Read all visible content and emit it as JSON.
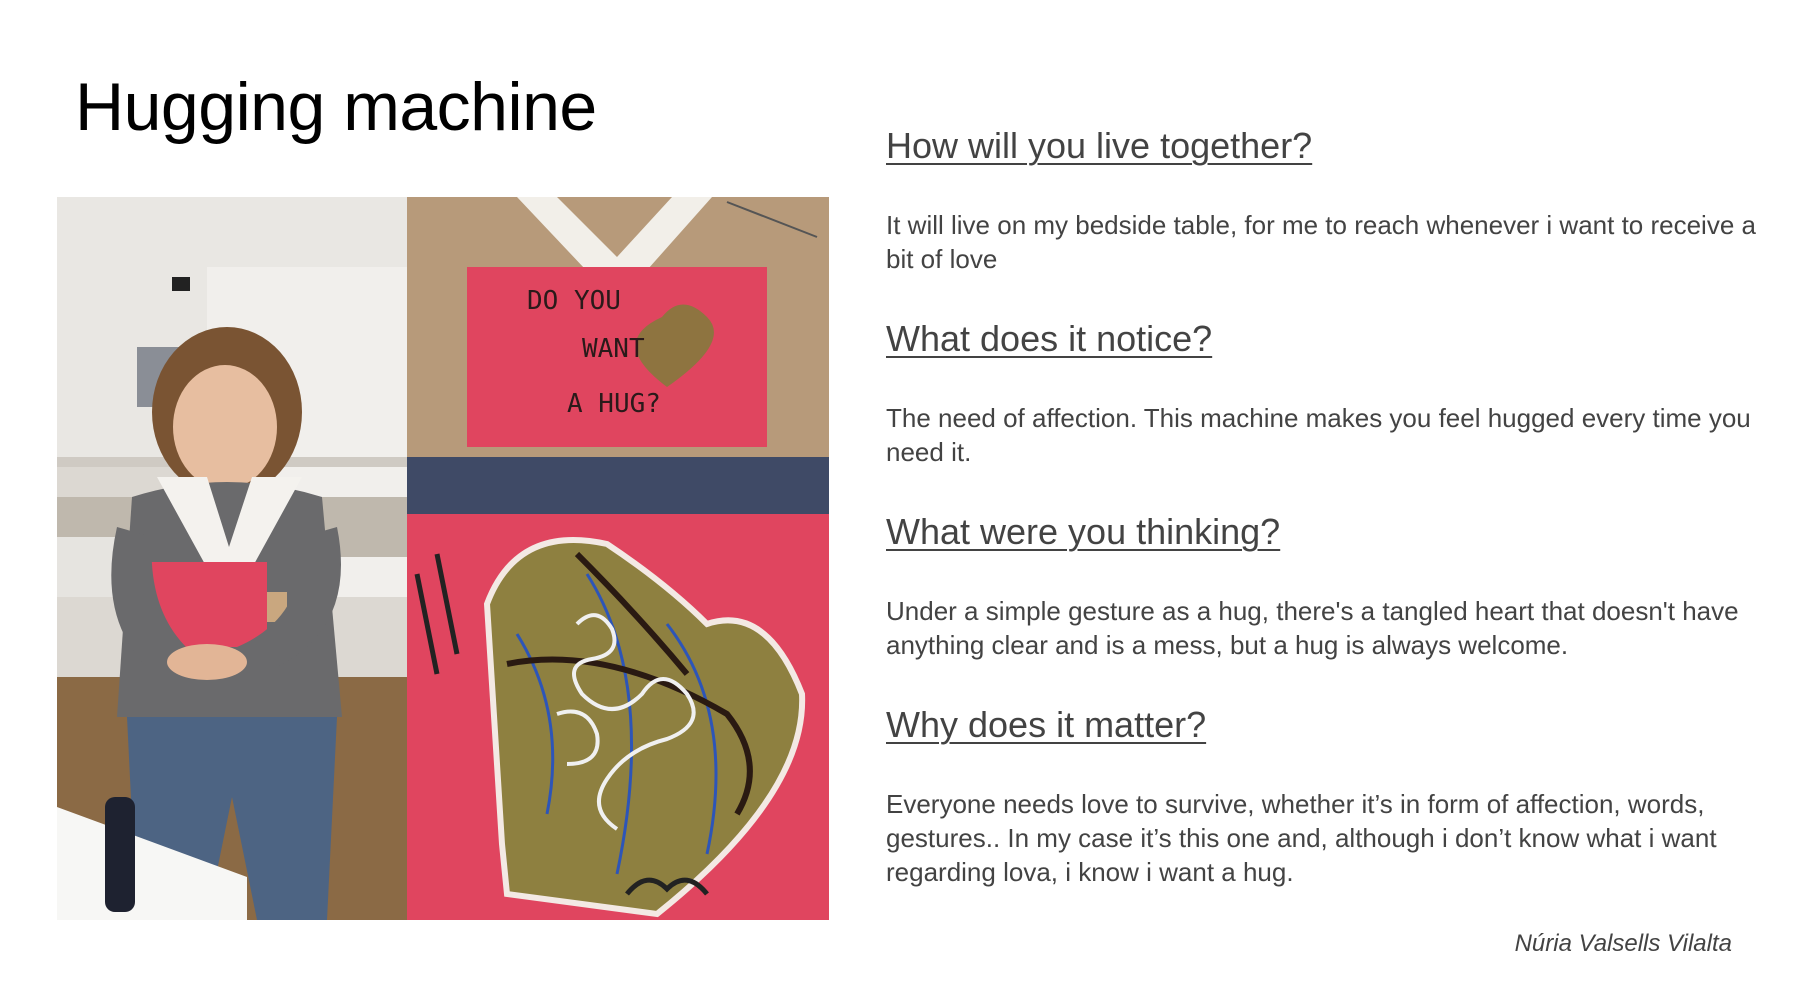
{
  "slide": {
    "title": "Hugging machine",
    "author": "Núria Valsells Vilalta"
  },
  "photos": {
    "person_sign_text": "DO YOU WANT A HUG?",
    "box_sign_lines": [
      "DO YOU",
      "WANT",
      "A HUG?"
    ]
  },
  "sections": [
    {
      "question": "How will you live together?",
      "answer": "It will live on my bedside table, for me to reach whenever i want to receive a bit of love"
    },
    {
      "question": "What does it notice?",
      "answer": "The need of affection. This machine makes you feel hugged every time you need it."
    },
    {
      "question": "What were you thinking?",
      "answer": "Under a simple gesture as a hug, there's a tangled heart that doesn't have anything clear and is a mess, but a hug is always welcome."
    },
    {
      "question": "Why does it matter?",
      "answer": "Everyone needs love to survive, whether it’s in form of affection, words, gestures.. In my case it’s this one and, although i don’t know what i want regarding lova, i know i want a hug."
    }
  ],
  "colors": {
    "text": "#434343",
    "sign_red": "#e0455f",
    "cardboard": "#b79a7a"
  }
}
